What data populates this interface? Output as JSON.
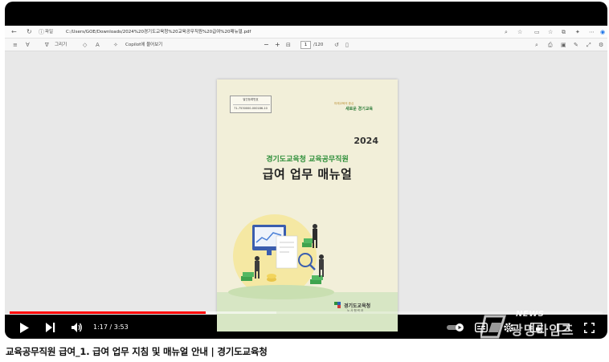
{
  "browser": {
    "site_info": "파일",
    "url": "C:/Users/GOE/Downloads/2024%20경기도교육청%20교육공무직원%20급여%20매뉴얼.pdf",
    "pdf_toolbar": {
      "draw_label": "그리기",
      "copilot_label": "Copilot에 물어보기",
      "zoom_out": "−",
      "zoom_in": "+",
      "page_current": "1",
      "page_total": "/120"
    }
  },
  "document": {
    "reg_label": "발간등록번호",
    "reg_code": "71-7530000-000186-10",
    "slogan_small": "미래교육의 중심",
    "slogan_brand": "새로운 경기교육",
    "year": "2024",
    "subtitle": "경기도교육청 교육공무직원",
    "title": "급여 업무 매뉴얼",
    "org": "경기도교육청",
    "org_sub": "노사협력과"
  },
  "player": {
    "time_current": "1:17",
    "time_separator": " / ",
    "time_total": "3:53",
    "progress_played": 0.331,
    "progress_loaded": 0.45
  },
  "watermark": {
    "news": "NEWS",
    "brand": "광명타임즈"
  },
  "video": {
    "title": "교육공무직원 급여_1. 급여 업무 지침 및 매뉴얼 안내 |  경기도교육청"
  },
  "colors": {
    "progress": "#ff0000",
    "doc_green": "#2f8f3a",
    "doc_bg": "#f2efd9"
  }
}
